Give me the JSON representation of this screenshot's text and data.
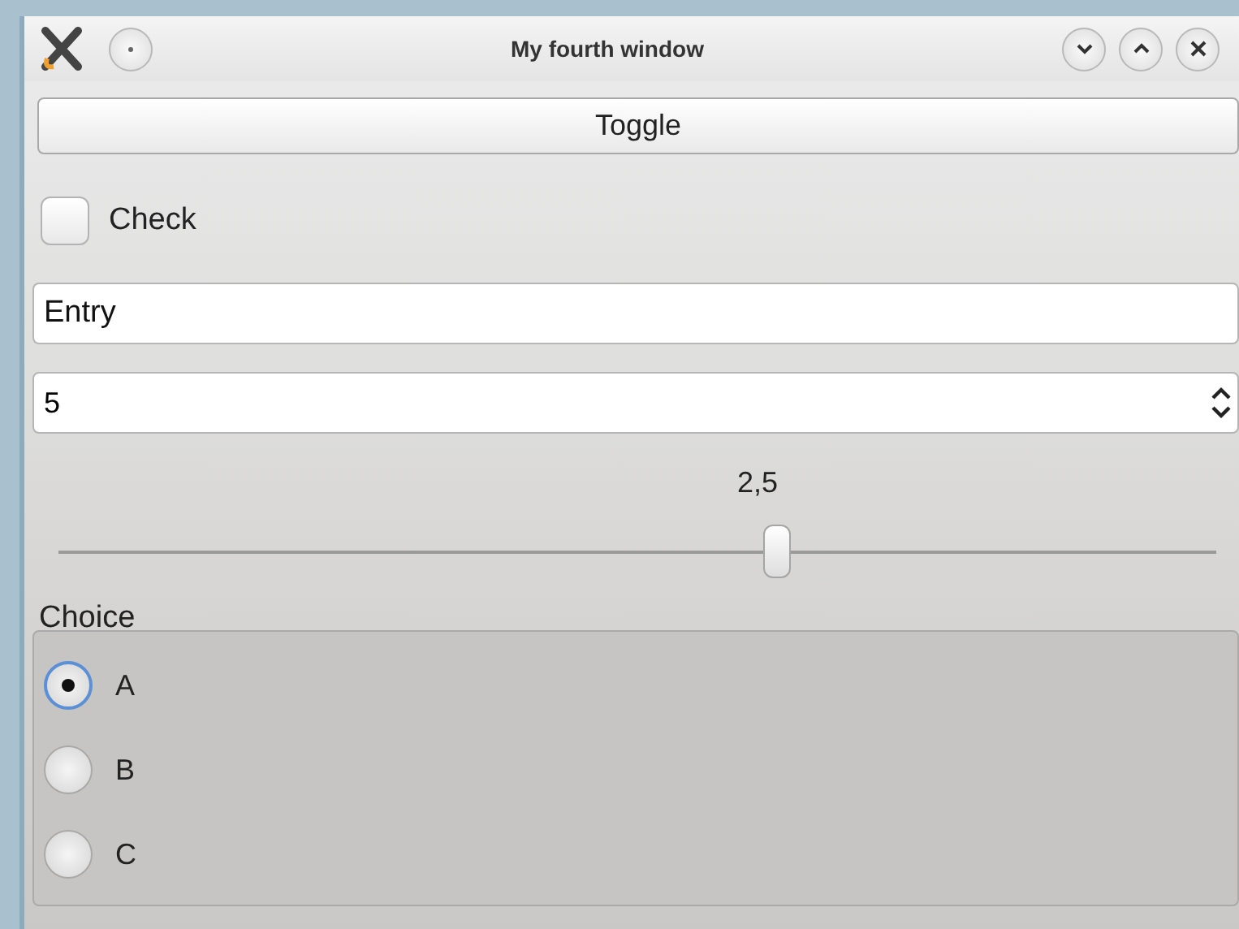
{
  "window": {
    "title": "My fourth window"
  },
  "toggle_button": {
    "label": "Toggle"
  },
  "checkbox": {
    "label": "Check",
    "checked": false
  },
  "entry": {
    "value": "Entry"
  },
  "spinbox": {
    "value": "5"
  },
  "slider": {
    "reading": "2,5",
    "level": 0.62
  },
  "choice_group": {
    "title": "Choice",
    "options": [
      {
        "label": "A",
        "selected": true
      },
      {
        "label": "B",
        "selected": false
      },
      {
        "label": "C",
        "selected": false
      }
    ]
  }
}
